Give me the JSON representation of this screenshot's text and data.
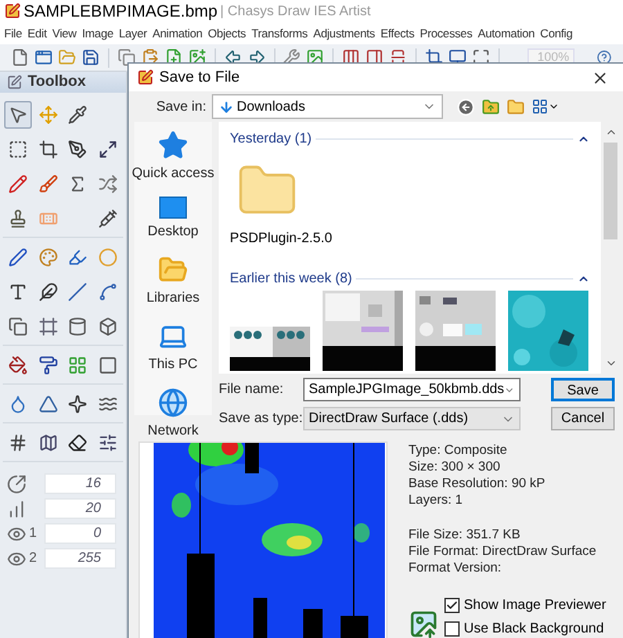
{
  "window": {
    "title": "SAMPLEBMPIMAGE.bmp",
    "app_name": "| Chasys Draw IES Artist"
  },
  "menu": [
    "File",
    "Edit",
    "View",
    "Image",
    "Layer",
    "Animation",
    "Objects",
    "Transforms",
    "Adjustments",
    "Effects",
    "Processes",
    "Automation",
    "Config"
  ],
  "toolbar": {
    "zoom": {
      "value": "100%",
      "disabled": true
    }
  },
  "toolbox": {
    "title": "Toolbox",
    "tools": [
      {
        "selected": true
      },
      {
        "selected": false
      },
      {
        "selected": false
      },
      {
        "selected": false
      },
      {
        "selected": false
      },
      {
        "selected": false
      },
      {
        "selected": false
      },
      {
        "selected": false
      },
      {
        "selected": false
      },
      {
        "selected": false
      },
      {
        "selected": false
      },
      {
        "selected": false
      },
      {
        "selected": false
      },
      {
        "selected": false
      },
      {
        "selected": false
      },
      {
        "selected": false
      },
      {
        "selected": false
      },
      {
        "selected": false
      },
      {
        "selected": false
      },
      {
        "selected": false
      },
      {
        "selected": false
      },
      {
        "selected": false
      },
      {
        "selected": false
      },
      {
        "selected": false
      },
      {
        "selected": false
      },
      {
        "selected": false
      },
      {
        "selected": false
      },
      {
        "selected": false
      },
      {
        "selected": false
      },
      {
        "selected": false
      },
      {
        "selected": false
      },
      {
        "selected": false
      },
      {
        "selected": false
      },
      {
        "selected": false
      },
      {
        "selected": false
      },
      {
        "selected": false
      },
      {
        "selected": false
      },
      {
        "selected": false
      }
    ],
    "fields": [
      {
        "kind": "size",
        "value": "16"
      },
      {
        "kind": "strength",
        "value": "20"
      },
      {
        "kind": "eye",
        "label": "1",
        "value": "0"
      },
      {
        "kind": "eye",
        "label": "2",
        "value": "255"
      }
    ]
  },
  "dialog": {
    "title": "Save to File",
    "save_in": {
      "label": "Save in:",
      "value": "Downloads"
    },
    "places": [
      {
        "kind": "star",
        "label": "Quick access"
      },
      {
        "kind": "desktop",
        "label": "Desktop"
      },
      {
        "kind": "libraries",
        "label": "Libraries"
      },
      {
        "kind": "pc",
        "label": "This PC"
      },
      {
        "kind": "network",
        "label": "Network"
      }
    ],
    "groups": [
      {
        "title": "Yesterday (1)",
        "items": [
          {
            "kind": "folder",
            "name": "PSDPlugin-2.5.0"
          }
        ]
      },
      {
        "title": "Earlier this week (8)"
      }
    ],
    "file_name": {
      "label": "File name:",
      "value": "SampleJPGImage_50kbmb.dds"
    },
    "save_type": {
      "label": "Save as type:",
      "value": "DirectDraw Surface (.dds)"
    },
    "buttons": [
      {
        "label": "Save",
        "default": true
      },
      {
        "label": "Cancel",
        "default": false
      }
    ],
    "info_blocks": [
      [
        "Type: Composite",
        "Size: 300 × 300",
        "Base Resolution: 90 kP",
        "Layers: 1"
      ],
      [
        "File Size: 351.7 KB",
        "File Format: DirectDraw Surface",
        "Format Version:"
      ]
    ],
    "options": [
      {
        "label": "Show Image Previewer",
        "checked": true
      },
      {
        "label": "Use Black Background",
        "checked": false
      }
    ]
  }
}
